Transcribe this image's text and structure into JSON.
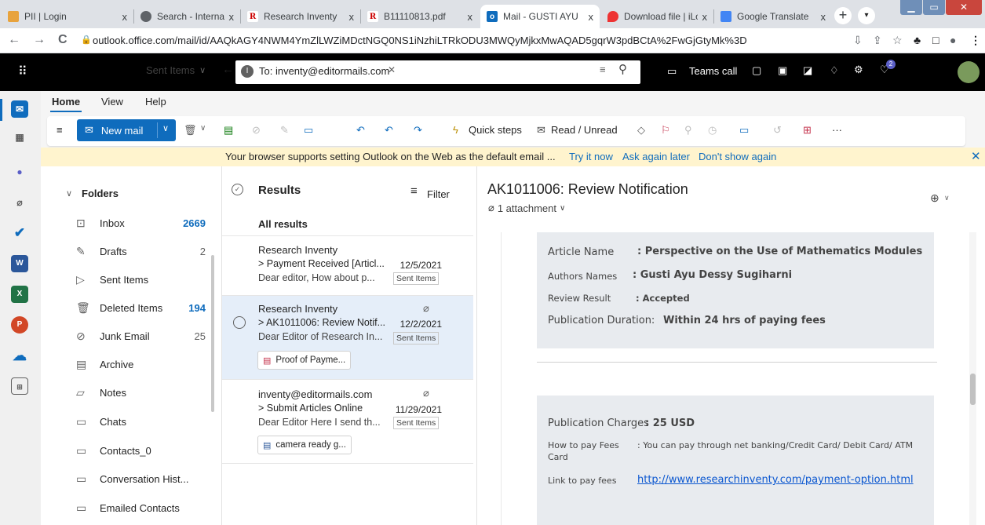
{
  "browser": {
    "tabs": [
      {
        "title": "PII | Login",
        "favicon": "pii-favicon"
      },
      {
        "title": "Search - Internatic",
        "favicon": "globe-favicon"
      },
      {
        "title": "Research Inventy",
        "favicon": "research-inventy-favicon"
      },
      {
        "title": "B11110813.pdf",
        "favicon": "research-inventy-favicon"
      },
      {
        "title": "Mail - GUSTI AYU",
        "favicon": "outlook-favicon"
      },
      {
        "title": "Download file | iLo",
        "favicon": "heart-favicon"
      },
      {
        "title": "Google Translate",
        "favicon": "google-translate-favicon"
      }
    ],
    "fav_letters": {
      "research": "R",
      "outlook": "o"
    },
    "new_tab": "+",
    "url": "outlook.office.com/mail/id/AAQkAGY4NWM4YmZlLWZiMDctNGQ0NS1iNzhiLTRkODU3MWQyMjkxMwAQAD5gqrW3pdBCtA%2FwGjGtyMk%3D",
    "glyphs": {
      "back": "←",
      "forward": "→",
      "reload": "C",
      "lock": "🔒",
      "star": "☆",
      "share": "⇪",
      "ext": "♣",
      "side": "□",
      "profile": "●",
      "menu": "⋮",
      "tab_close": "x"
    }
  },
  "outlook": {
    "topbar": {
      "folder_selector": "Sent Items",
      "to_label": "To: inventy@editormails.com",
      "to_badge": "I",
      "teams_call": "Teams call",
      "notif_count": "2"
    },
    "ribbon_tabs": [
      "Home",
      "View",
      "Help"
    ],
    "ribbon": {
      "new_mail": "New mail",
      "quick_steps": "Quick steps",
      "read_unread": "Read / Unread",
      "more": "···"
    },
    "banner": {
      "text": "Your browser supports setting Outlook on the Web as the default email ...",
      "try_it_now": "Try it now",
      "ask_later": "Ask again later",
      "dont_show": "Don't show again"
    },
    "folders": {
      "header": "Folders",
      "items": [
        {
          "label": "Inbox",
          "count": "2669",
          "icon": "inbox-icon"
        },
        {
          "label": "Drafts",
          "count": "2",
          "icon": "pencil-icon"
        },
        {
          "label": "Sent Items",
          "count": "",
          "icon": "send-icon"
        },
        {
          "label": "Deleted Items",
          "count": "194",
          "icon": "trash-icon"
        },
        {
          "label": "Junk Email",
          "count": "25",
          "icon": "junk-icon"
        },
        {
          "label": "Archive",
          "count": "",
          "icon": "archive-icon"
        },
        {
          "label": "Notes",
          "count": "",
          "icon": "note-icon"
        },
        {
          "label": "Chats",
          "count": "",
          "icon": "folder-icon"
        },
        {
          "label": "Contacts_0",
          "count": "",
          "icon": "folder-icon"
        },
        {
          "label": "Conversation Hist...",
          "count": "",
          "icon": "folder-icon"
        },
        {
          "label": "Emailed Contacts",
          "count": "",
          "icon": "folder-icon"
        }
      ]
    },
    "results": {
      "header": "Results",
      "filter": "Filter",
      "all_results": "All results",
      "messages": [
        {
          "sender": "Research Inventy",
          "subject": "> Payment Received [Articl...",
          "date": "12/5/2021",
          "preview": "Dear editor, How about p...",
          "folder": "Sent Items",
          "attachment": ""
        },
        {
          "sender": "Research Inventy",
          "subject": "> AK1011006: Review Notif...",
          "date": "12/2/2021",
          "preview": "Dear Editor of Research In...",
          "folder": "Sent Items",
          "attachment": "Proof of Payme..."
        },
        {
          "sender": "inventy@editormails.com",
          "subject": "> Submit Articles Online",
          "date": "11/29/2021",
          "preview": "Dear Editor Here I send th...",
          "folder": "Sent Items",
          "attachment": "camera ready g..."
        }
      ]
    },
    "reading": {
      "subject": "AK1011006: Review Notification",
      "attachments": "1 attachment",
      "card1": {
        "article_name_label": "Article Name",
        "article_name_value": ": Perspective on the Use of Mathematics Modules",
        "authors_label": "Authors Names",
        "authors_value": ": Gusti Ayu Dessy Sugiharni",
        "review_label": "Review Result",
        "review_value": ": Accepted",
        "duration_label": "Publication Duration:",
        "duration_value": "Within 24 hrs of paying fees"
      },
      "card2": {
        "charges_label": "Publication Charges",
        "charges_value": ": 25 USD",
        "how_label": "How to pay Fees",
        "how_label2": "Card",
        "how_value": ": You can pay through net banking/Credit Card/ Debit Card/ ATM",
        "link_label": "Link to pay fees",
        "link_value": "http://www.researchinventy.com/payment-option.html"
      }
    }
  }
}
